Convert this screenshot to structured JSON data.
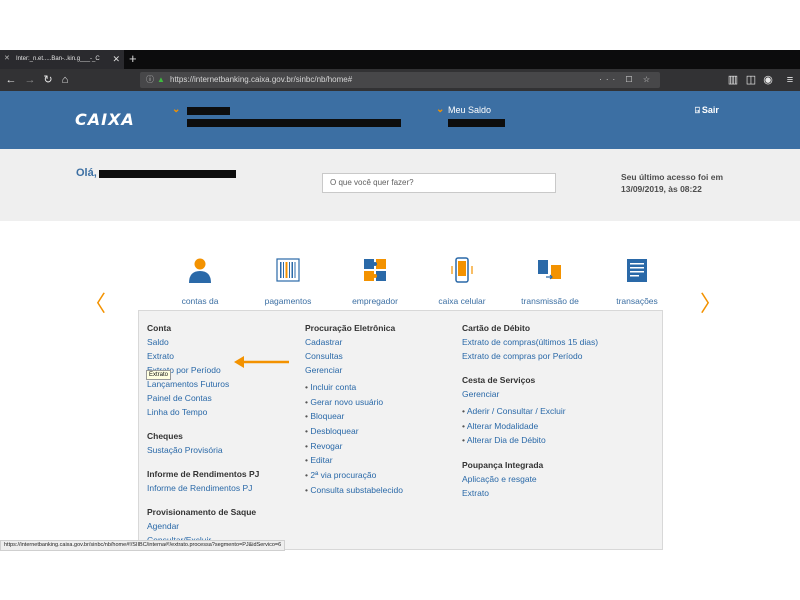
{
  "browser": {
    "tab_title": "Inter:_n.et.....Ban-..kin.g___-_C",
    "tab_close": "✕",
    "newtab": "+",
    "url": "https://internetbanking.caixa.gov.br/sinbc/nb/home#",
    "url_actions": "··· ☐ ☆"
  },
  "header": {
    "logo": "CAIXA",
    "meu_saldo": "Meu Saldo",
    "sair": "Sair"
  },
  "greeting": {
    "ola": "Olá,",
    "search_placeholder": "O que você quer fazer?",
    "last_access": "Seu último acesso foi em 13/09/2019, às 08:22"
  },
  "carousel": {
    "items": [
      {
        "label": "contas da",
        "icon": "person-icon"
      },
      {
        "label": "pagamentos",
        "icon": "barcode-icon"
      },
      {
        "label": "empregador",
        "icon": "puzzle-icon"
      },
      {
        "label": "caixa celular",
        "icon": "phone-icon"
      },
      {
        "label": "transmissão de",
        "icon": "file-transfer-icon"
      },
      {
        "label": "transações",
        "icon": "receipt-icon"
      }
    ]
  },
  "menu": {
    "col1": {
      "conta_head": "Conta",
      "conta_items": [
        "Saldo",
        "Extrato",
        "Extrato por Período",
        "Lançamentos Futuros",
        "Painel de Contas",
        "Linha do Tempo"
      ],
      "cheques_head": "Cheques",
      "cheques_items": [
        "Sustação Provisória"
      ],
      "informe_head": "Informe de Rendimentos PJ",
      "informe_items": [
        "Informe de Rendimentos PJ"
      ],
      "saque_head": "Provisionamento de Saque",
      "saque_items": [
        "Agendar",
        "Consultar/Excluir"
      ]
    },
    "col2": {
      "head": "Procuração Eletrônica",
      "items": [
        "Cadastrar",
        "Consultas",
        "Gerenciar"
      ],
      "bullets": [
        "Incluir conta",
        "Gerar novo usuário",
        "Bloquear",
        "Desbloquear",
        "Revogar",
        "Editar",
        "2ª via procuração",
        "Consulta substabelecido"
      ]
    },
    "col3": {
      "debito_head": "Cartão de Débito",
      "debito_items": [
        "Extrato de compras(últimos 15 dias)",
        "Extrato de compras por Período"
      ],
      "cesta_head": "Cesta de Serviços",
      "cesta_items": [
        "Gerenciar"
      ],
      "cesta_bullets": [
        "Aderir / Consultar / Excluir",
        "Alterar Modalidade",
        "Alterar Dia de Débito"
      ],
      "poupanca_head": "Poupança Integrada",
      "poupanca_items": [
        "Aplicação e resgate",
        "Extrato"
      ]
    }
  },
  "tooltip": "Extrato",
  "status_url": "https://internetbanking.caixa.gov.br/sinbc/nb/home#!/SIIBC/interna#!/extrato.processa?segmento=PJ&idServico=6",
  "colors": {
    "header_blue": "#3c6fa3",
    "accent_orange": "#f39200",
    "link_blue": "#2a69a8"
  }
}
